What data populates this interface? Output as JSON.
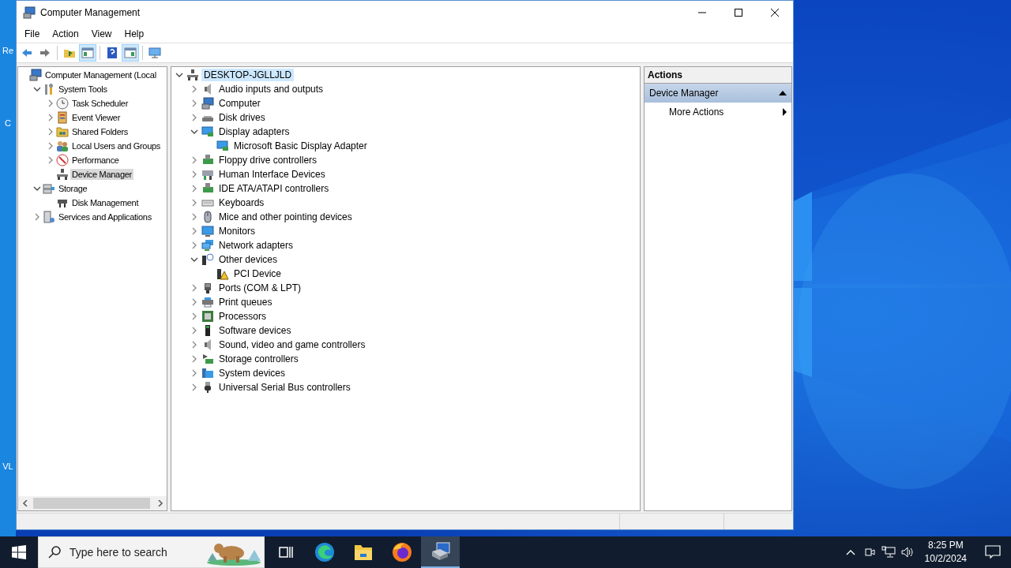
{
  "desktop": {
    "icons": [
      {
        "label": "Re"
      },
      {
        "label": "C"
      },
      {
        "label": "VL"
      }
    ]
  },
  "window": {
    "title": "Computer Management"
  },
  "menu": [
    "File",
    "Action",
    "View",
    "Help"
  ],
  "toolbar": [
    {
      "pressed": false
    },
    {
      "pressed": false
    },
    {
      "pressed": false
    },
    {
      "pressed": true
    },
    {
      "pressed": false
    },
    {
      "pressed": true
    },
    {
      "pressed": false
    }
  ],
  "console_tree": [
    {
      "label": "Computer Management (Local",
      "selected": false,
      "children": [
        {
          "label": "System Tools",
          "expanded": true,
          "selected": false,
          "children": [
            {
              "label": "Task Scheduler",
              "expanded": false,
              "selected": false
            },
            {
              "label": "Event Viewer",
              "expanded": false,
              "selected": false
            },
            {
              "label": "Shared Folders",
              "expanded": false,
              "selected": false
            },
            {
              "label": "Local Users and Groups",
              "expanded": false,
              "selected": false
            },
            {
              "label": "Performance",
              "expanded": false,
              "selected": false
            },
            {
              "label": "Device Manager",
              "selected": true
            }
          ]
        },
        {
          "label": "Storage",
          "expanded": true,
          "selected": false,
          "children": [
            {
              "label": "Disk Management",
              "selected": false
            }
          ]
        },
        {
          "label": "Services and Applications",
          "expanded": false,
          "selected": false
        }
      ]
    }
  ],
  "device_tree": [
    {
      "label": "DESKTOP-JGLLJLD",
      "expanded": true,
      "selected": true,
      "children": [
        {
          "label": "Audio inputs and outputs",
          "expanded": false,
          "selected": false
        },
        {
          "label": "Computer",
          "expanded": false,
          "selected": false
        },
        {
          "label": "Disk drives",
          "expanded": false,
          "selected": false
        },
        {
          "label": "Display adapters",
          "expanded": true,
          "selected": false,
          "children": [
            {
              "label": "Microsoft Basic Display Adapter",
              "selected": false
            }
          ]
        },
        {
          "label": "Floppy drive controllers",
          "expanded": false,
          "selected": false
        },
        {
          "label": "Human Interface Devices",
          "expanded": false,
          "selected": false
        },
        {
          "label": "IDE ATA/ATAPI controllers",
          "expanded": false,
          "selected": false
        },
        {
          "label": "Keyboards",
          "expanded": false,
          "selected": false
        },
        {
          "label": "Mice and other pointing devices",
          "expanded": false,
          "selected": false
        },
        {
          "label": "Monitors",
          "expanded": false,
          "selected": false
        },
        {
          "label": "Network adapters",
          "expanded": false,
          "selected": false
        },
        {
          "label": "Other devices",
          "expanded": true,
          "selected": false,
          "children": [
            {
              "label": "PCI Device",
              "selected": false
            }
          ]
        },
        {
          "label": "Ports (COM & LPT)",
          "expanded": false,
          "selected": false
        },
        {
          "label": "Print queues",
          "expanded": false,
          "selected": false
        },
        {
          "label": "Processors",
          "expanded": false,
          "selected": false
        },
        {
          "label": "Software devices",
          "expanded": false,
          "selected": false
        },
        {
          "label": "Sound, video and game controllers",
          "expanded": false,
          "selected": false
        },
        {
          "label": "Storage controllers",
          "expanded": false,
          "selected": false
        },
        {
          "label": "System devices",
          "expanded": false,
          "selected": false
        },
        {
          "label": "Universal Serial Bus controllers",
          "expanded": false,
          "selected": false
        }
      ]
    }
  ],
  "actions": {
    "title": "Actions",
    "section": {
      "label": "Device Manager",
      "expanded": true
    },
    "items": [
      {
        "label": "More Actions"
      }
    ]
  },
  "taskbar": {
    "search": {
      "placeholder": "Type here to search"
    },
    "apps": [
      {
        "active": false
      },
      {
        "active": false
      },
      {
        "active": false
      },
      {
        "active": false
      },
      {
        "active": true
      }
    ],
    "time": "8:25 PM",
    "date": "10/2/2024"
  }
}
